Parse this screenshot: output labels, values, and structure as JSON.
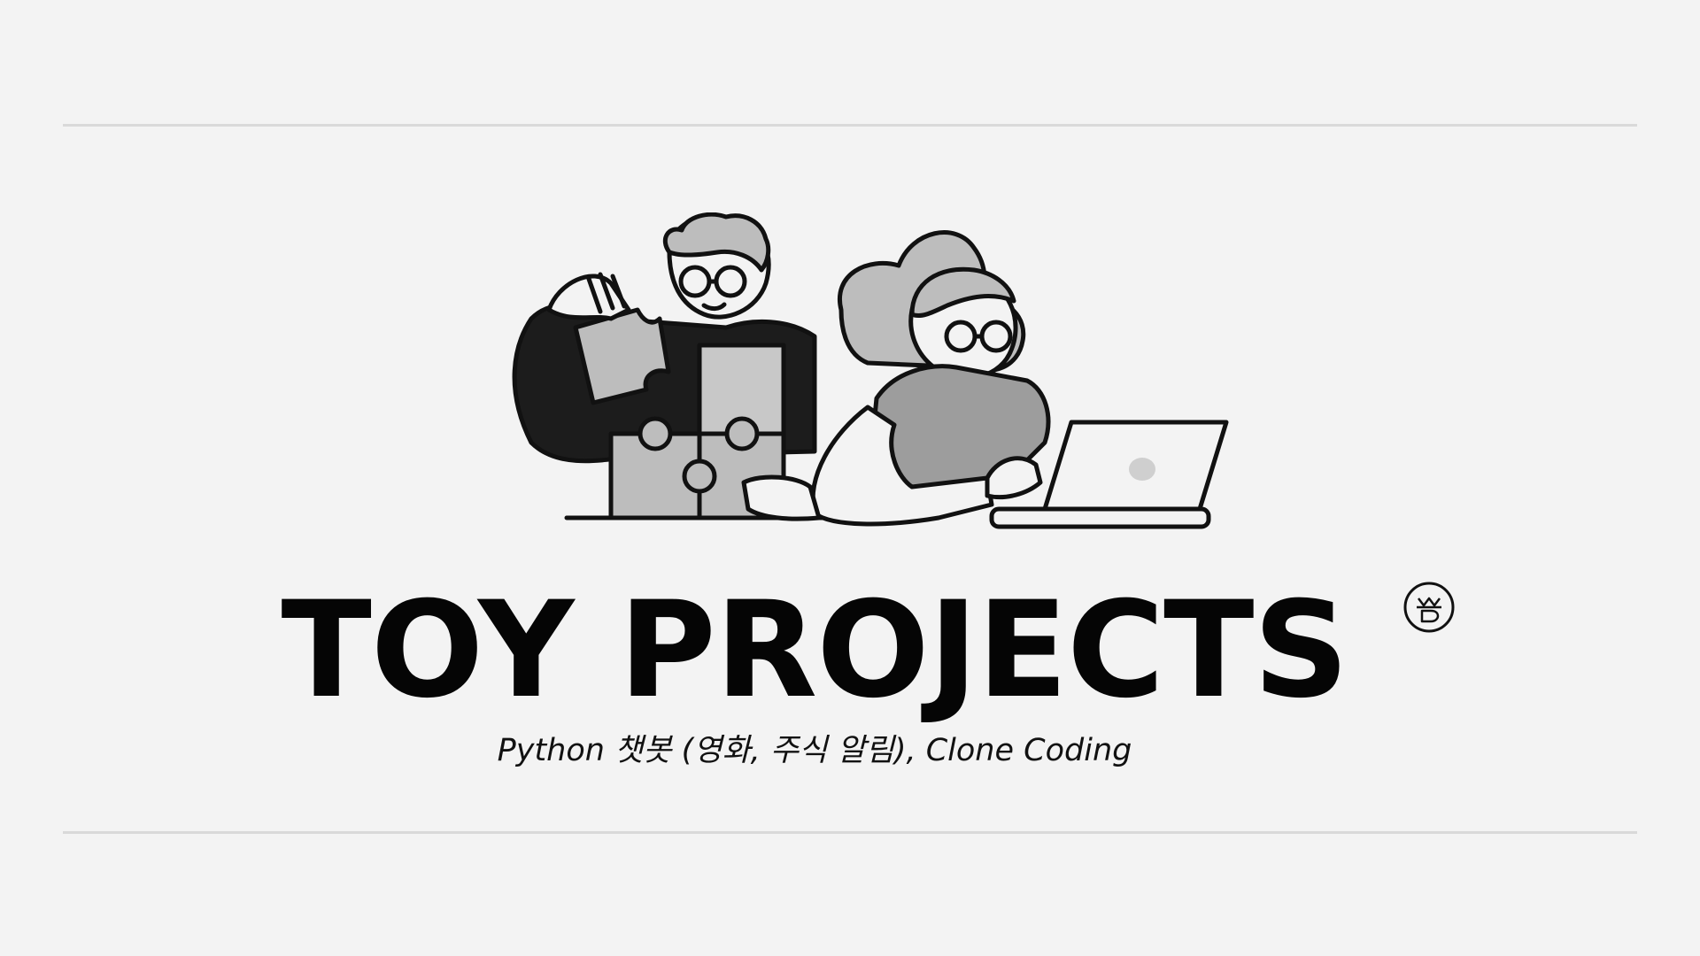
{
  "slide": {
    "title": "TOY PROJECTS",
    "subtitle": "Python 챗봇 (영화, 주식 알림), Clone Coding"
  },
  "illustration": {
    "icon": "two-people-puzzle-laptop-illustration"
  },
  "logo": {
    "icon": "md-badge-logo"
  },
  "colors": {
    "background": "#f3f3f3",
    "rule": "#d9d9d9",
    "text": "#050505"
  }
}
